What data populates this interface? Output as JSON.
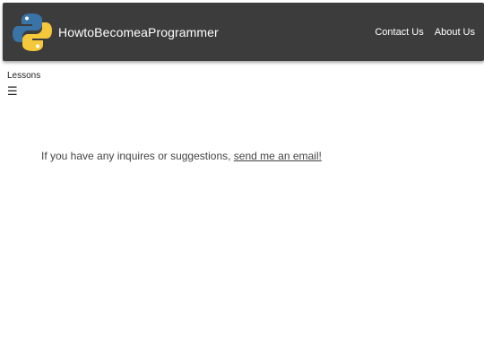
{
  "header": {
    "site_title": "HowtoBecomeaProgrammer",
    "logo_icon": "python-logo-icon",
    "background_color": "#3c3c3c",
    "nav": {
      "contact": "Contact Us",
      "about": "About Us"
    }
  },
  "sidebar": {
    "lessons_label": "Lessons",
    "menu_icon": "☰"
  },
  "main": {
    "contact_prefix": "If you have any inquires or suggestions, ",
    "contact_link": "send me an email!"
  },
  "colors": {
    "python_blue": "#3a73a6",
    "python_yellow": "#f5c83b"
  }
}
